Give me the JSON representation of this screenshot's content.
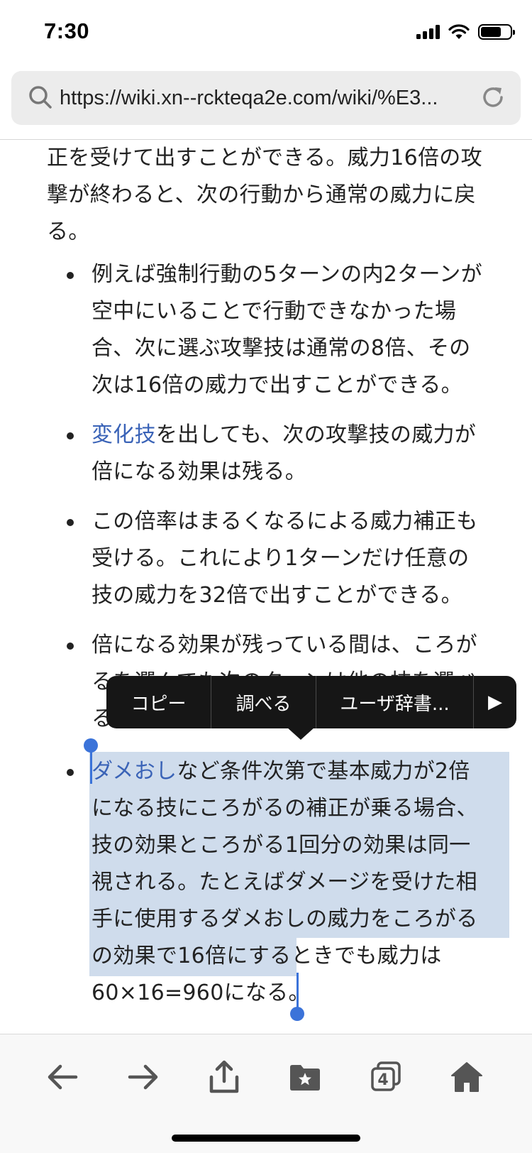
{
  "status_bar": {
    "time": "7:30"
  },
  "browser": {
    "url": "https://wiki.xn--rckteqa2e.com/wiki/%E3..."
  },
  "article": {
    "intro_lines": [
      "正を受けて出すことができる。威力16倍の攻",
      "撃が終わると、次の行動から通常の威力に戻",
      "る。"
    ],
    "bullet1": [
      "例えば強制行動の5ターンの内2ターンが",
      "空中にいることで行動できなかった場",
      "合、次に選ぶ攻撃技は通常の8倍、その",
      "次は16倍の威力で出すことができる。"
    ],
    "bullet2_link": "変化技",
    "bullet2_rest": "を出しても、次の攻撃技の威力が",
    "bullet2_line2": "倍になる効果は残る。",
    "bullet3": [
      "この倍率はまるくなるによる威力補正も",
      "受ける。これにより1ターンだけ任意の",
      "技の威力を32倍で出すことができる。"
    ],
    "bullet4": [
      "倍になる効果が残っている間は、ころが",
      "るを選んでも次のターンは他の技を選べ",
      "る。"
    ],
    "bullet5_link": "ダメおし",
    "bullet5_rest": "など条件次第で基本威力が2倍",
    "bullet5_lines": [
      "になる技にころがるの補正が乗る場合、",
      "技の効果ところがる1回分の効果は同一",
      "視される。たとえばダメージを受けた相",
      "手に使用するダメおしの威力をころがる",
      "の効果で16倍にするときでも威力は",
      "60×16=960になる。"
    ]
  },
  "context_menu": {
    "copy": "コピー",
    "lookup": "調べる",
    "user_dict": "ユーザ辞書...",
    "more": "▶"
  },
  "toolbar": {
    "tab_count": "4"
  }
}
